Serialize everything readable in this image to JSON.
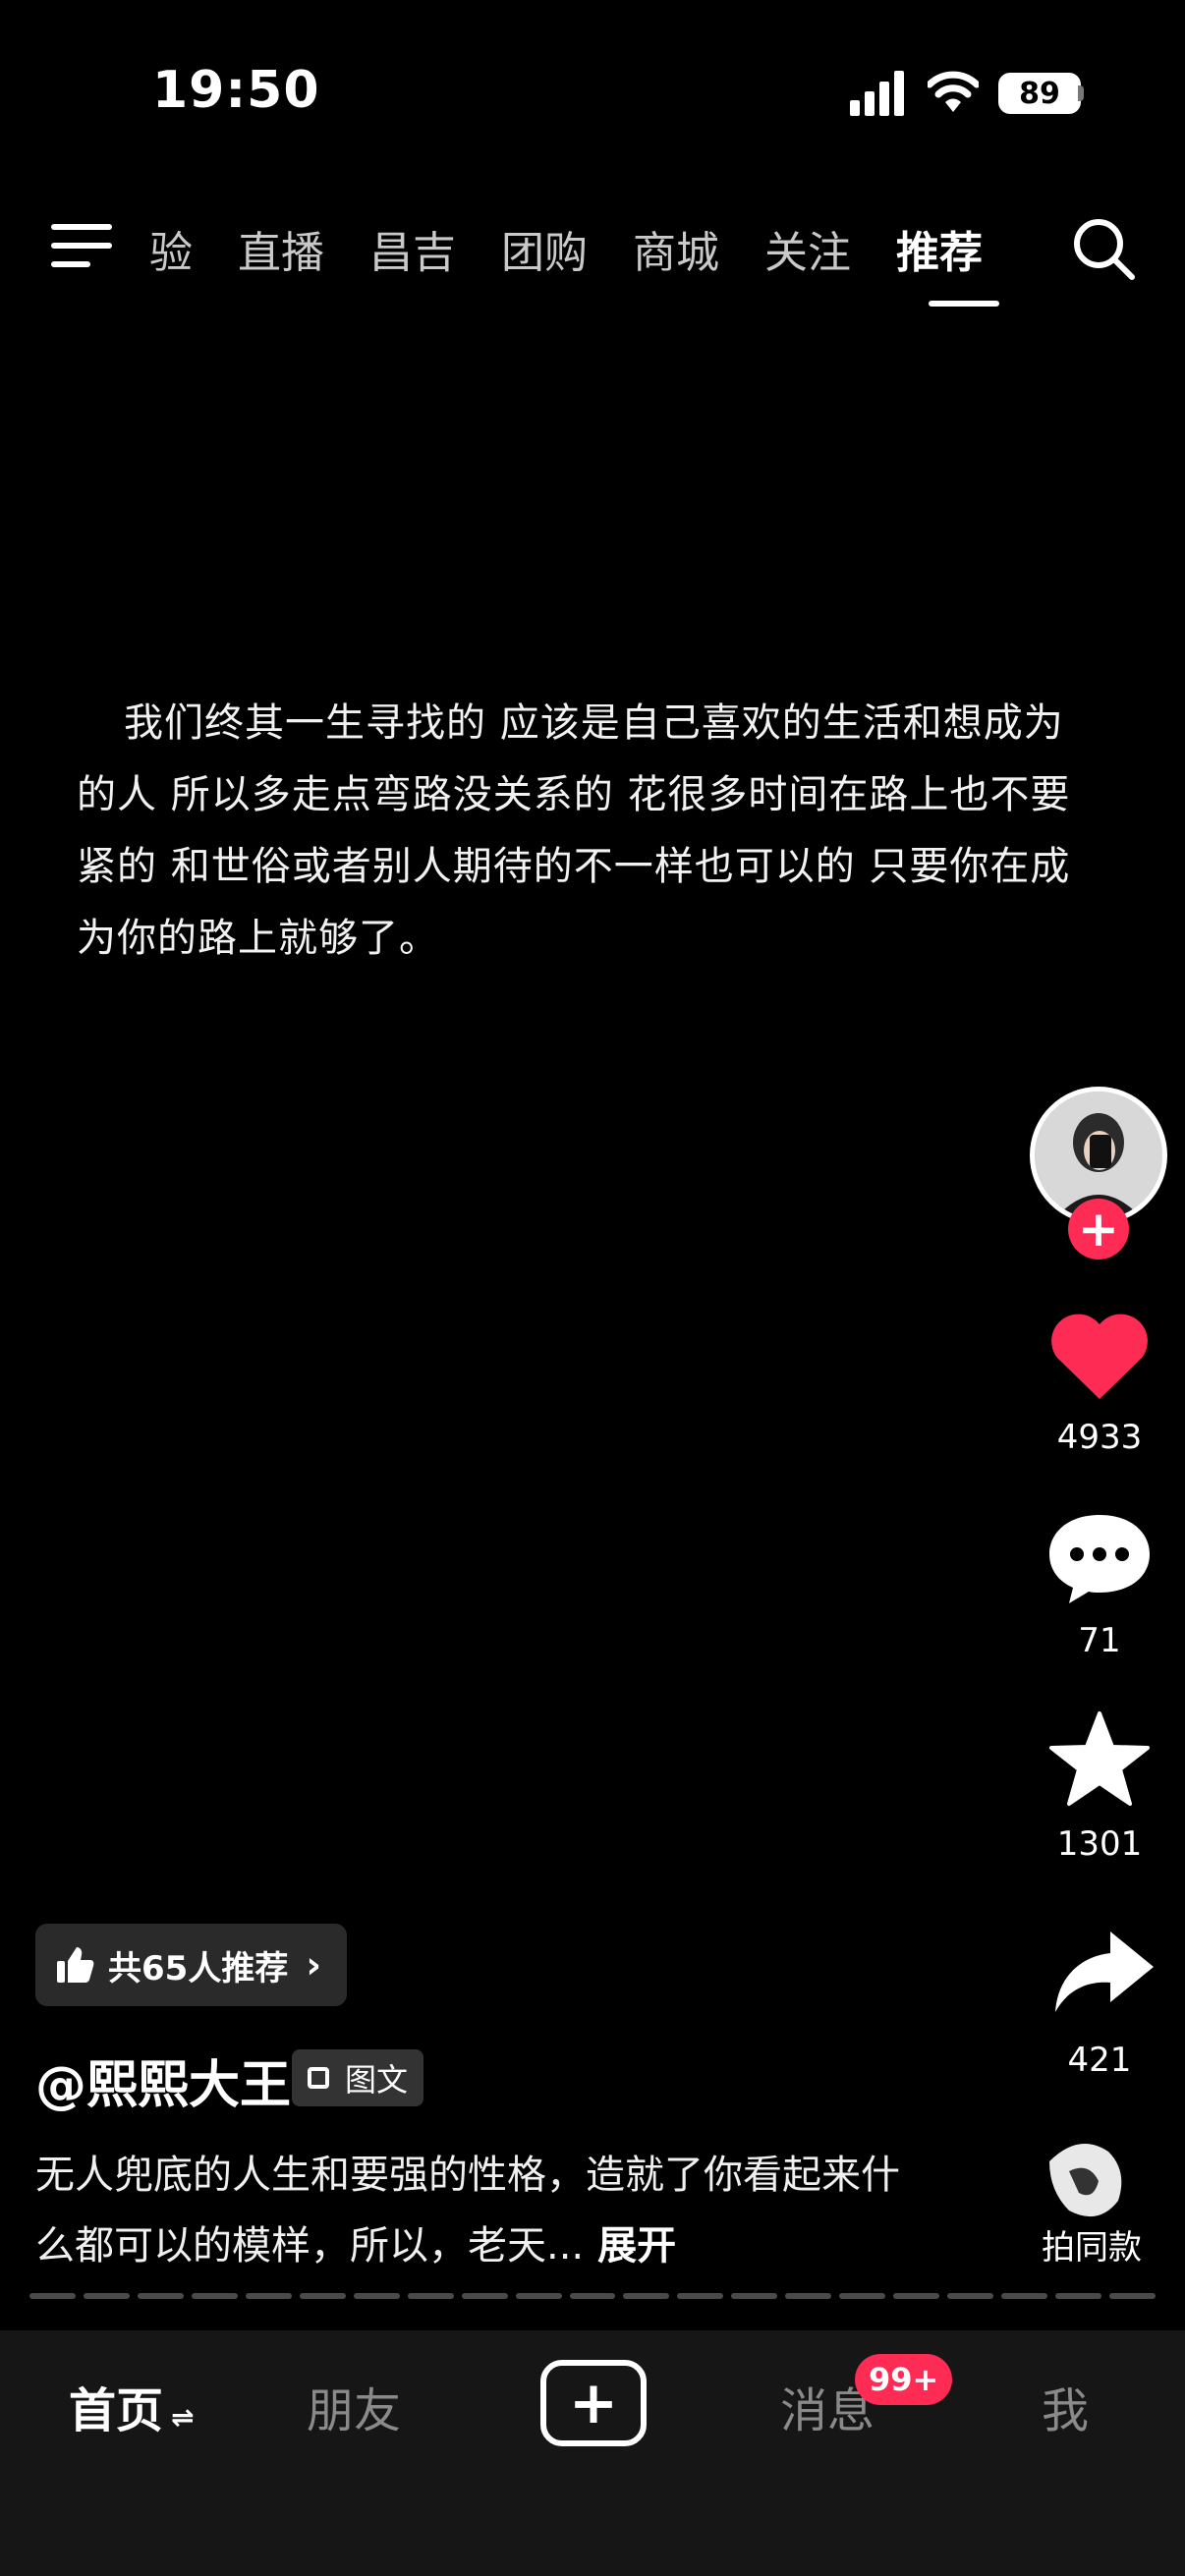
{
  "status_bar": {
    "time": "19:50",
    "battery": "89"
  },
  "top_nav": {
    "tabs": [
      "验",
      "直播",
      "昌吉",
      "团购",
      "商城",
      "关注",
      "推荐"
    ],
    "active_tab": "推荐"
  },
  "post": {
    "text": "我们终其一生寻找的  应该是自己喜欢的生活和想成为的人  所以多走点弯路没关系的  花很多时间在路上也不要紧的  和世俗或者别人期待的不一样也可以的   只要你在成为你的路上就够了。"
  },
  "actions": {
    "likes": "4933",
    "comments": "71",
    "favorites": "1301",
    "shares": "421",
    "follow_symbol": "+",
    "music_label": "拍同款"
  },
  "info": {
    "recommend_chip": "共65人推荐",
    "author": "@熙熙大王",
    "type_badge": "图文",
    "caption": "无人兜底的人生和要强的性格，造就了你看起来什么都可以的模样，所以，老天...",
    "expand_label": "展开"
  },
  "bottom_tabs": {
    "home": "首页",
    "home_suffix": "⇌",
    "friends": "朋友",
    "create_symbol": "+",
    "messages": "消息",
    "messages_badge": "99+",
    "me": "我"
  },
  "colors": {
    "accent": "#fe2c55",
    "background": "#000000",
    "tabbar": "#161616"
  }
}
